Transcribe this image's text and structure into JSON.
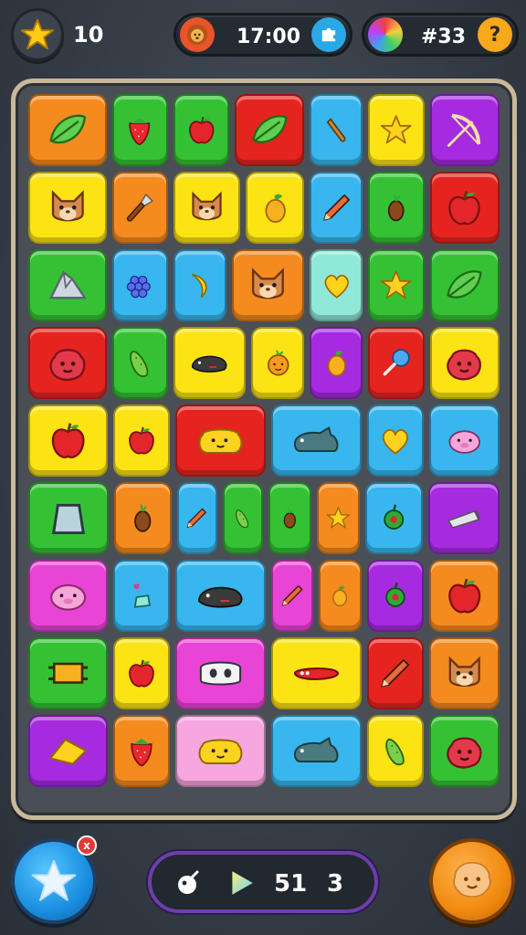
{
  "top_bar": {
    "star_count": "10",
    "timer": "17:00",
    "gem_count": "#33",
    "help_label": "?"
  },
  "colors": {
    "orange": "#f58a1f",
    "green": "#34c234",
    "red": "#e52420",
    "blue": "#38b6ee",
    "yellow": "#fbe314",
    "purple": "#a62be0",
    "pink": "#f7a6e0",
    "magenta": "#e844d6",
    "teal": "#8fe8d8"
  },
  "board": {
    "rows": [
      [
        {
          "color": "orange",
          "icon": "leaf-icon",
          "span": 1.4
        },
        {
          "color": "green",
          "icon": "strawberry-icon",
          "span": 1
        },
        {
          "color": "green",
          "icon": "apple-icon",
          "span": 1
        },
        {
          "color": "red",
          "icon": "leaf-icon",
          "span": 1.25
        },
        {
          "color": "blue",
          "icon": "carrot-icon",
          "span": 0.95
        },
        {
          "color": "yellow",
          "icon": "star-icon",
          "span": 1
        },
        {
          "color": "purple",
          "icon": "bow-icon",
          "span": 1.25
        }
      ],
      [
        {
          "color": "yellow",
          "icon": "cat-face-icon",
          "span": 1.4
        },
        {
          "color": "orange",
          "icon": "brush-icon",
          "span": 1
        },
        {
          "color": "yellow",
          "icon": "cat-face-icon",
          "span": 1.2
        },
        {
          "color": "yellow",
          "icon": "mango-icon",
          "span": 1.05
        },
        {
          "color": "blue",
          "icon": "pencil-icon",
          "span": 0.95
        },
        {
          "color": "green",
          "icon": "seed-icon",
          "span": 1
        },
        {
          "color": "red",
          "icon": "apple-icon",
          "span": 1.25
        }
      ],
      [
        {
          "color": "green",
          "icon": "rock-icon",
          "span": 1.4
        },
        {
          "color": "blue",
          "icon": "grapes-icon",
          "span": 1
        },
        {
          "color": "blue",
          "icon": "banana-icon",
          "span": 0.95
        },
        {
          "color": "orange",
          "icon": "cat-face-icon",
          "span": 1.3
        },
        {
          "color": "teal",
          "icon": "heart-icon",
          "span": 0.95
        },
        {
          "color": "green",
          "icon": "star-icon",
          "span": 1
        },
        {
          "color": "green",
          "icon": "leaf-icon",
          "span": 1.25
        }
      ],
      [
        {
          "color": "red",
          "icon": "blob-face-icon",
          "span": 1.4
        },
        {
          "color": "green",
          "icon": "cucumber-icon",
          "span": 1
        },
        {
          "color": "yellow",
          "icon": "mole-icon",
          "span": 1.3
        },
        {
          "color": "yellow",
          "icon": "orange-fruit-icon",
          "span": 0.95
        },
        {
          "color": "purple",
          "icon": "mango-icon",
          "span": 0.95
        },
        {
          "color": "red",
          "icon": "lollipop-icon",
          "span": 1
        },
        {
          "color": "yellow",
          "icon": "blob-face-icon",
          "span": 1.25
        }
      ],
      [
        {
          "color": "yellow",
          "icon": "apple-icon",
          "span": 1.4
        },
        {
          "color": "yellow",
          "icon": "apple-icon",
          "span": 1
        },
        {
          "color": "red",
          "icon": "bear-icon",
          "span": 1.6
        },
        {
          "color": "blue",
          "icon": "dino-icon",
          "span": 1.6
        },
        {
          "color": "blue",
          "icon": "heart-icon",
          "span": 1
        },
        {
          "color": "blue",
          "icon": "pig-face-icon",
          "span": 1.25
        }
      ],
      [
        {
          "color": "green",
          "icon": "cube-icon",
          "span": 1.4
        },
        {
          "color": "orange",
          "icon": "seed-icon",
          "span": 1
        },
        {
          "color": "blue",
          "icon": "pencil-icon",
          "span": 0.7
        },
        {
          "color": "green",
          "icon": "cucumber-icon",
          "span": 0.7
        },
        {
          "color": "green",
          "icon": "seed-icon",
          "span": 0.75
        },
        {
          "color": "orange",
          "icon": "star-icon",
          "span": 0.75
        },
        {
          "color": "blue",
          "icon": "pepper-icon",
          "span": 1
        },
        {
          "color": "purple",
          "icon": "tube-icon",
          "span": 1.25
        }
      ],
      [
        {
          "color": "magenta",
          "icon": "pig-face-icon",
          "span": 1.4
        },
        {
          "color": "blue",
          "icon": "gems-icon",
          "span": 1
        },
        {
          "color": "blue",
          "icon": "mole-icon",
          "span": 1.6
        },
        {
          "color": "magenta",
          "icon": "pencil-icon",
          "span": 0.75
        },
        {
          "color": "orange",
          "icon": "mango-icon",
          "span": 0.75
        },
        {
          "color": "purple",
          "icon": "pepper-icon",
          "span": 1
        },
        {
          "color": "orange",
          "icon": "apple-icon",
          "span": 1.25
        }
      ],
      [
        {
          "color": "green",
          "icon": "frame-icon",
          "span": 1.4
        },
        {
          "color": "yellow",
          "icon": "apple-icon",
          "span": 1
        },
        {
          "color": "magenta",
          "icon": "panda-icon",
          "span": 1.6
        },
        {
          "color": "yellow",
          "icon": "sausage-icon",
          "span": 1.6
        },
        {
          "color": "red",
          "icon": "pencil-icon",
          "span": 1
        },
        {
          "color": "orange",
          "icon": "cat-face-icon",
          "span": 1.25
        }
      ],
      [
        {
          "color": "purple",
          "icon": "cheese-icon",
          "span": 1.4
        },
        {
          "color": "orange",
          "icon": "strawberry-icon",
          "span": 1
        },
        {
          "color": "pink",
          "icon": "bear-icon",
          "span": 1.6
        },
        {
          "color": "blue",
          "icon": "dino-icon",
          "span": 1.6
        },
        {
          "color": "yellow",
          "icon": "cucumber-icon",
          "span": 1
        },
        {
          "color": "green",
          "icon": "blob-face-icon",
          "span": 1.25
        }
      ]
    ]
  },
  "bottom_bar": {
    "notification_badge": "x",
    "score": "51",
    "moves": "3"
  }
}
